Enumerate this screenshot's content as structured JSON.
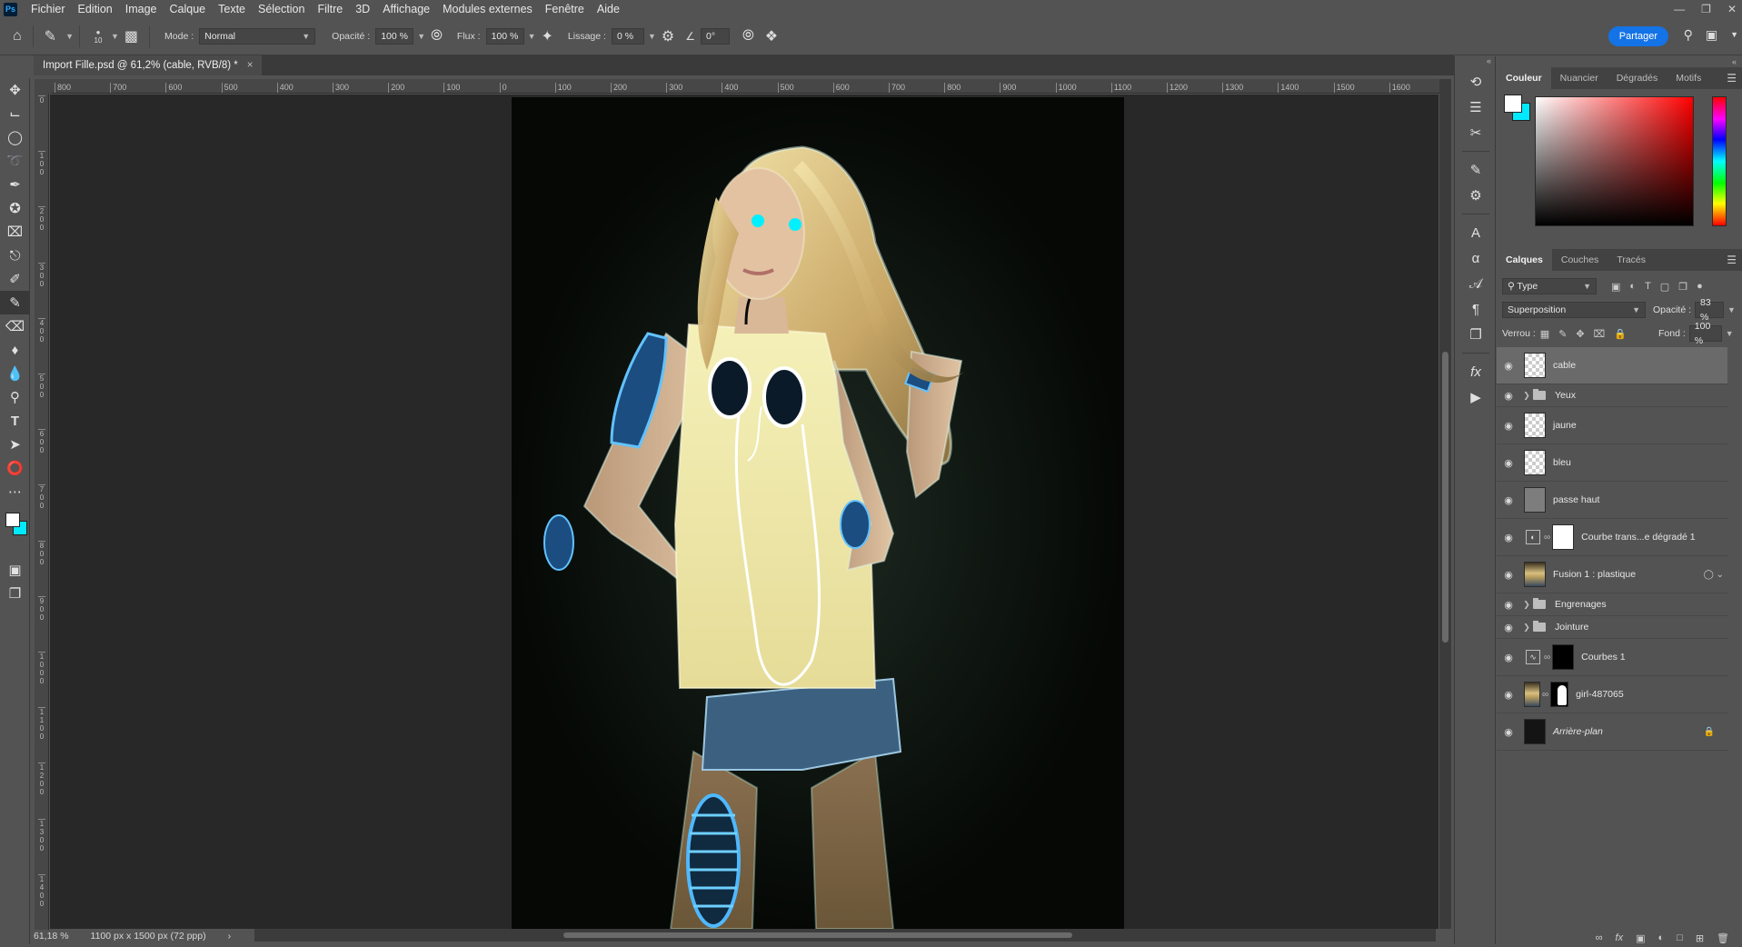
{
  "app": {
    "logo": "Ps"
  },
  "menu": [
    "Fichier",
    "Edition",
    "Image",
    "Calque",
    "Texte",
    "Sélection",
    "Filtre",
    "3D",
    "Affichage",
    "Modules externes",
    "Fenêtre",
    "Aide"
  ],
  "options": {
    "brush_size": "10",
    "mode_label": "Mode :",
    "mode_value": "Normal",
    "opacity_label": "Opacité :",
    "opacity_value": "100 %",
    "flow_label": "Flux :",
    "flow_value": "100 %",
    "smoothing_label": "Lissage :",
    "smoothing_value": "0 %",
    "angle_value": "0°",
    "share_label": "Partager"
  },
  "document": {
    "tab_title": "Import Fille.psd @ 61,2% (cable, RVB/8) *",
    "close": "×"
  },
  "ruler_h": [
    "800",
    "700",
    "600",
    "500",
    "400",
    "300",
    "200",
    "100",
    "0",
    "100",
    "200",
    "300",
    "400",
    "500",
    "600",
    "700",
    "800",
    "900",
    "1000",
    "1100",
    "1200",
    "1300",
    "1400",
    "1500",
    "1600"
  ],
  "ruler_v": [
    "0",
    "1 0 0",
    "2 0 0",
    "3 0 0",
    "4 0 0",
    "5 0 0",
    "6 0 0",
    "7 0 0",
    "8 0 0",
    "9 0 0",
    "1 0 0 0",
    "1 1 0 0",
    "1 2 0 0",
    "1 3 0 0",
    "1 4 0 0"
  ],
  "status": {
    "zoom": "61,18 %",
    "doc_info": "1100 px x 1500 px (72 ppp)",
    "arrow": "›"
  },
  "colors": {
    "foreground": "#ffffff",
    "background": "#00eaff",
    "accent": "#1473e6"
  },
  "color_panel": {
    "tabs": [
      "Couleur",
      "Nuancier",
      "Dégradés",
      "Motifs"
    ]
  },
  "layers_panel": {
    "tabs": [
      "Calques",
      "Couches",
      "Tracés"
    ],
    "filter_value": "Type",
    "blend_mode": "Superposition",
    "opacity_label": "Opacité :",
    "opacity_value": "83 %",
    "lock_label": "Verrou :",
    "fill_label": "Fond :",
    "fill_value": "100 %",
    "layers": [
      {
        "name": "cable",
        "kind": "pixel",
        "thumb": "transparent",
        "selected": true
      },
      {
        "name": "Yeux",
        "kind": "group"
      },
      {
        "name": "jaune",
        "kind": "pixel",
        "thumb": "transparent"
      },
      {
        "name": "bleu",
        "kind": "pixel",
        "thumb": "transparent"
      },
      {
        "name": "passe haut",
        "kind": "pixel",
        "thumb": "gray"
      },
      {
        "name": "Courbe trans...e dégradé 1",
        "kind": "adjustment",
        "mask": "white"
      },
      {
        "name": "Fusion 1 : plastique",
        "kind": "smart",
        "thumb": "photo"
      },
      {
        "name": "Engrenages",
        "kind": "group"
      },
      {
        "name": "Jointure",
        "kind": "group"
      },
      {
        "name": "Courbes 1",
        "kind": "adjustment",
        "mask": "black"
      },
      {
        "name": "girl-487065",
        "kind": "masked",
        "thumb": "photo",
        "mask": "girl"
      },
      {
        "name": "Arrière-plan",
        "kind": "background",
        "thumb": "dark",
        "locked": true
      }
    ]
  }
}
